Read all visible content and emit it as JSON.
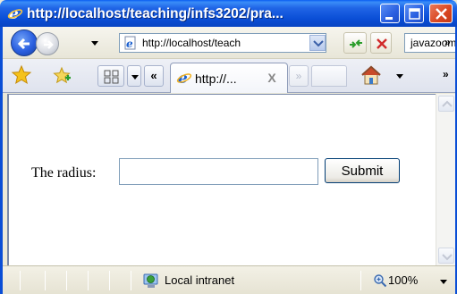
{
  "window": {
    "title": "http://localhost/teaching/infs3202/pra...",
    "title_icon": "ie-logo-icon"
  },
  "toolbar": {
    "address": "http://localhost/teach",
    "search_value": "javazoom",
    "overflow_chevron": "»"
  },
  "tabs": {
    "scroll_left": "«",
    "scroll_right": "»",
    "active_tab": {
      "label": "http://...",
      "close": "X"
    },
    "overflow_chevron": "»"
  },
  "form": {
    "label": "The radius:",
    "radius_value": "",
    "submit_label": "Submit"
  },
  "statusbar": {
    "zone": "Local intranet",
    "zoom": "100%"
  },
  "colors": {
    "titlebar": "#0a4ed6",
    "close_button": "#d94520",
    "content_bg": "#ffffff"
  }
}
